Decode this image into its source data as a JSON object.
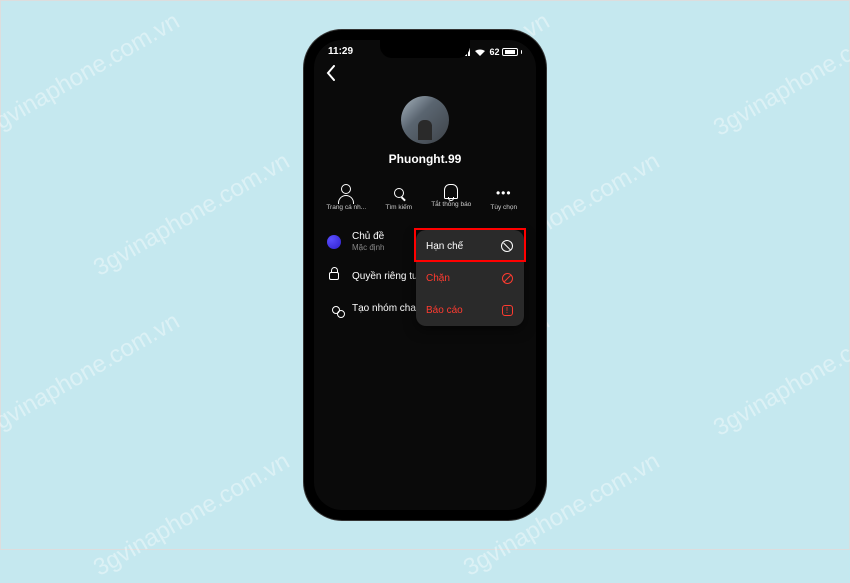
{
  "status": {
    "time": "11:29",
    "battery_pct": "62"
  },
  "profile": {
    "username": "Phuonght.99"
  },
  "actions": {
    "profile": "Trang cá nh...",
    "search": "Tìm kiếm",
    "mute": "Tắt thông báo",
    "options": "Tùy chọn"
  },
  "menu": {
    "theme_label": "Chủ đề",
    "theme_sub": "Mặc định",
    "privacy_label": "Quyền riêng tư & an t...",
    "group_label": "Tạo nhóm chat"
  },
  "popover": {
    "restrict": "Hạn chế",
    "block": "Chặn",
    "report": "Báo cáo"
  },
  "watermark": "3gvinaphone.com.vn"
}
